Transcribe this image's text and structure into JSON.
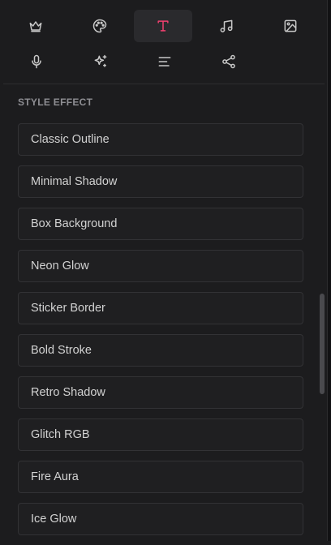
{
  "toolbar": {
    "row1": [
      {
        "icon": "crown-icon",
        "active": false
      },
      {
        "icon": "palette-icon",
        "active": false
      },
      {
        "icon": "text-icon",
        "active": true
      },
      {
        "icon": "music-icon",
        "active": false
      },
      {
        "icon": "image-icon",
        "active": false
      }
    ],
    "row2": [
      {
        "icon": "microphone-icon",
        "active": false
      },
      {
        "icon": "sparkles-icon",
        "active": false
      },
      {
        "icon": "align-left-icon",
        "active": false
      },
      {
        "icon": "share-icon",
        "active": false
      }
    ],
    "active_color": "#f0406f"
  },
  "style_effect": {
    "title": "STYLE EFFECT",
    "items": [
      "Classic Outline",
      "Minimal Shadow",
      "Box Background",
      "Neon Glow",
      "Sticker Border",
      "Bold Stroke",
      "Retro Shadow",
      "Glitch RGB",
      "Fire Aura",
      "Ice Glow"
    ]
  }
}
